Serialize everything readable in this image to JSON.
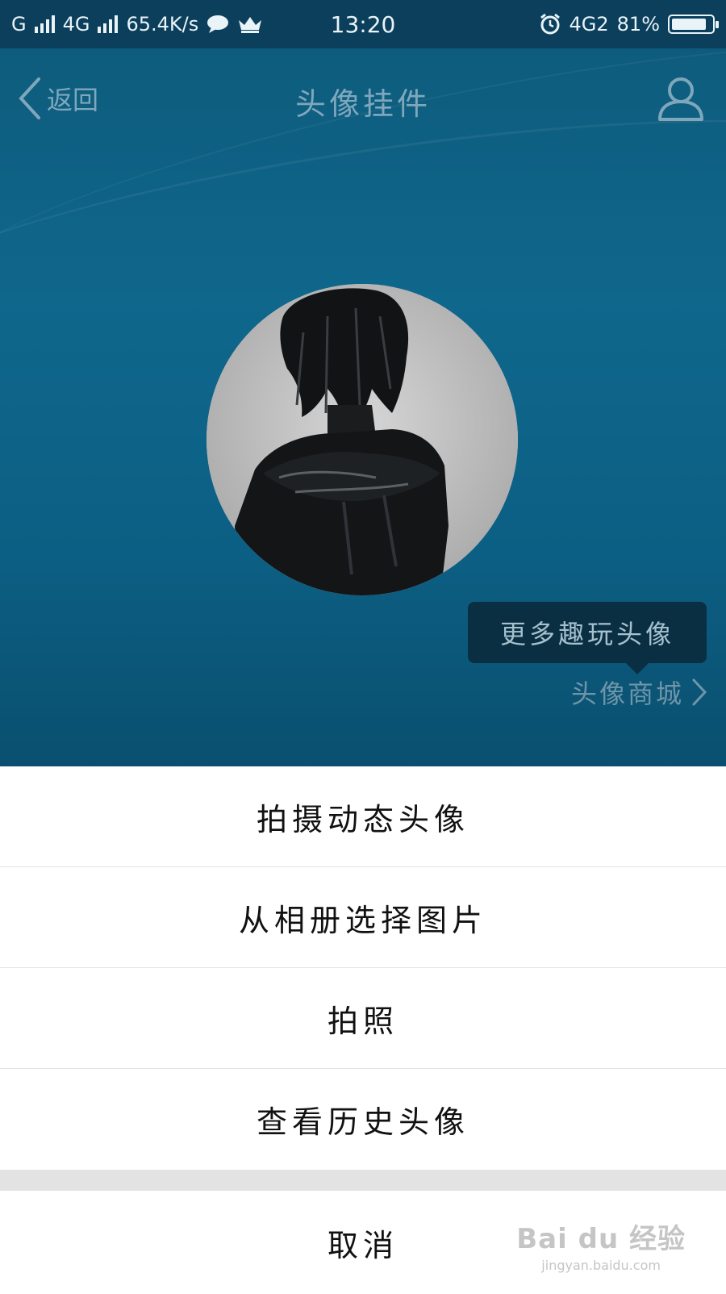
{
  "status_bar": {
    "carrier_1": "G",
    "carrier_2": "4G",
    "net_speed": "65.4K/s",
    "time": "13:20",
    "network_right": "4G2",
    "battery_percent": "81%",
    "battery_level": 0.81
  },
  "nav": {
    "back_label": "返回",
    "title": "头像挂件"
  },
  "hero": {
    "tooltip_text": "更多趣玩头像",
    "shop_link_label": "头像商城"
  },
  "sheet": {
    "items": [
      {
        "label": "拍摄动态头像"
      },
      {
        "label": "从相册选择图片"
      },
      {
        "label": "拍照"
      },
      {
        "label": "查看历史头像"
      }
    ],
    "cancel_label": "取消"
  },
  "watermark": {
    "logo": "Bai du 经验",
    "url": "jingyan.baidu.com"
  }
}
